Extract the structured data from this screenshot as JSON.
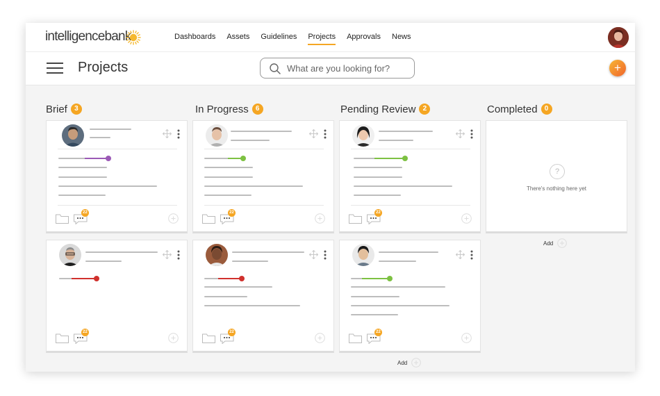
{
  "brand": {
    "name": "intelligencebank"
  },
  "nav": [
    {
      "label": "Dashboards",
      "active": false
    },
    {
      "label": "Assets",
      "active": false
    },
    {
      "label": "Guidelines",
      "active": false
    },
    {
      "label": "Projects",
      "active": true
    },
    {
      "label": "Approvals",
      "active": false
    },
    {
      "label": "News",
      "active": false
    }
  ],
  "header": {
    "title": "Projects",
    "menu_icon": "hamburger-menu-icon",
    "add_icon": "plus-icon"
  },
  "search": {
    "placeholder": "What are you looking for?",
    "value": ""
  },
  "colors": {
    "accent": "#f5a623",
    "purple": "#9b59b6",
    "green": "#7dc142",
    "red": "#d0312d"
  },
  "columns": [
    {
      "title": "Brief",
      "count": "3"
    },
    {
      "title": "In Progress",
      "count": "6"
    },
    {
      "title": "Pending Review",
      "count": "2"
    },
    {
      "title": "Completed",
      "count": "0"
    }
  ],
  "cards": {
    "comment_count": "22"
  },
  "empty": {
    "text": "There's nothing here yet",
    "icon": "question-mark-icon"
  },
  "add_label": "Add"
}
